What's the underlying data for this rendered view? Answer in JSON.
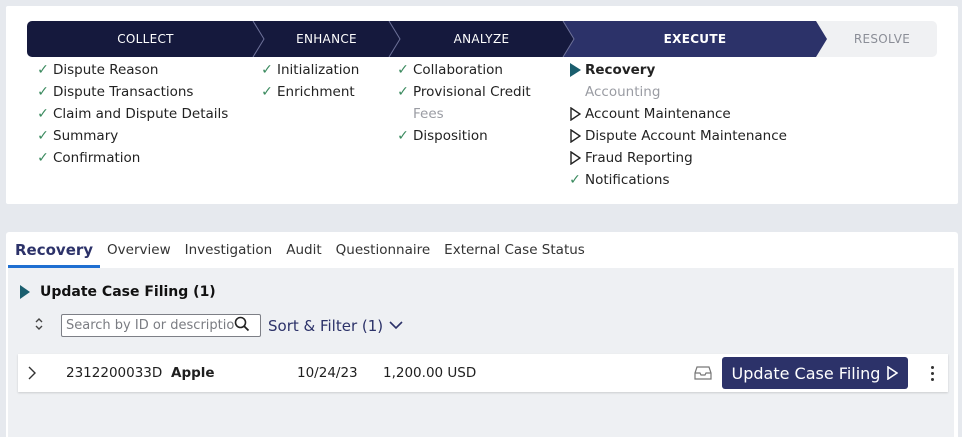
{
  "stages": [
    {
      "label": "COLLECT",
      "state": "done"
    },
    {
      "label": "ENHANCE",
      "state": "done"
    },
    {
      "label": "ANALYZE",
      "state": "done"
    },
    {
      "label": "EXECUTE",
      "state": "current"
    },
    {
      "label": "RESOLVE",
      "state": "future"
    }
  ],
  "steps": {
    "collect": [
      {
        "label": "Dispute Reason",
        "status": "complete"
      },
      {
        "label": "Dispute Transactions",
        "status": "complete"
      },
      {
        "label": "Claim and Dispute Details",
        "status": "complete"
      },
      {
        "label": "Summary",
        "status": "complete"
      },
      {
        "label": "Confirmation",
        "status": "complete"
      }
    ],
    "enhance": [
      {
        "label": "Initialization",
        "status": "complete"
      },
      {
        "label": "Enrichment",
        "status": "complete"
      }
    ],
    "analyze": [
      {
        "label": "Collaboration",
        "status": "complete"
      },
      {
        "label": "Provisional Credit",
        "status": "complete"
      },
      {
        "label": "Fees",
        "status": "skipped"
      },
      {
        "label": "Disposition",
        "status": "complete"
      }
    ],
    "execute": [
      {
        "label": "Recovery",
        "status": "active"
      },
      {
        "label": "Accounting",
        "status": "skipped"
      },
      {
        "label": "Account Maintenance",
        "status": "pending"
      },
      {
        "label": "Dispute Account Maintenance",
        "status": "pending"
      },
      {
        "label": "Fraud Reporting",
        "status": "pending"
      },
      {
        "label": "Notifications",
        "status": "complete"
      }
    ]
  },
  "tabs": [
    {
      "label": "Recovery",
      "active": true
    },
    {
      "label": "Overview"
    },
    {
      "label": "Investigation"
    },
    {
      "label": "Audit"
    },
    {
      "label": "Questionnaire"
    },
    {
      "label": "External Case Status"
    }
  ],
  "section": {
    "title": "Update Case Filing (1)"
  },
  "search": {
    "placeholder": "Search by ID or description"
  },
  "filter": {
    "label": "Sort & Filter (1)"
  },
  "rows": [
    {
      "case_id": "2312200033D",
      "merchant": "Apple",
      "date": "10/24/23",
      "amount": "1,200.00 USD",
      "action": "Update Case Filing"
    }
  ],
  "colors": {
    "stage_done": "#15193d",
    "stage_current": "#2c3269",
    "check": "#3a8a5e",
    "accent_tab": "#1f6fd1",
    "active_step_marker": "#1a5e6e"
  },
  "icons": {
    "complete": "check-icon",
    "pending": "play-outline-icon",
    "active": "play-filled-icon"
  }
}
